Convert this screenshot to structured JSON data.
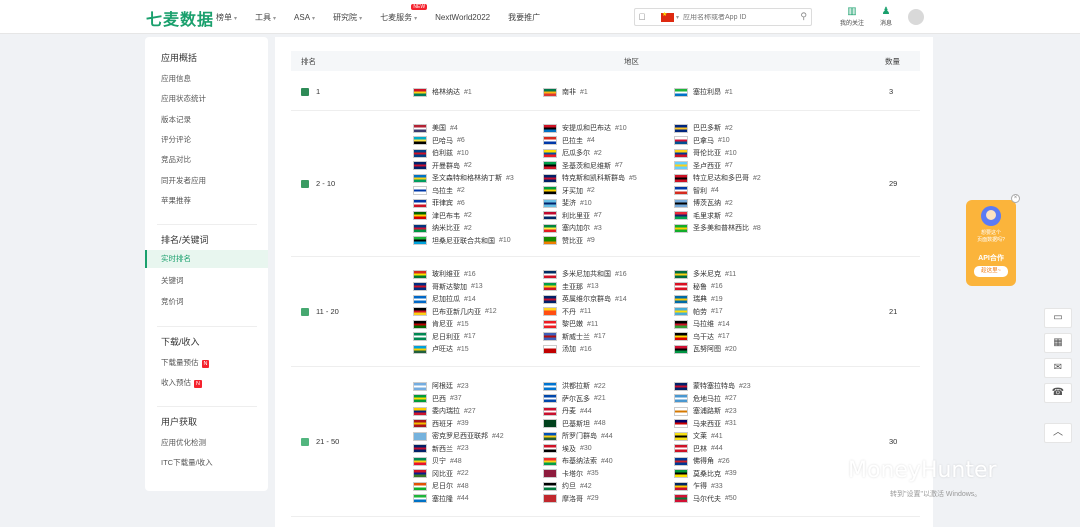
{
  "header": {
    "logo": "七麦数据",
    "nav": [
      {
        "label": "榜单",
        "caret": true
      },
      {
        "label": "工具",
        "caret": true
      },
      {
        "label": "ASA",
        "caret": true
      },
      {
        "label": "研究院",
        "caret": true
      },
      {
        "label": "七麦服务",
        "caret": true,
        "badge": "NEW"
      },
      {
        "label": "NextWorld2022",
        "caret": false
      },
      {
        "label": "我要推广",
        "caret": false
      }
    ],
    "search_placeholder": "应用名称或者App ID",
    "my_follow": "我的关注",
    "message": "消息"
  },
  "sidebar": {
    "groups": [
      {
        "title": "应用概括",
        "items": [
          {
            "label": "应用信息"
          },
          {
            "label": "应用状态统计"
          },
          {
            "label": "版本记录"
          },
          {
            "label": "评分评论"
          },
          {
            "label": "竞品对比"
          },
          {
            "label": "同开发者应用"
          },
          {
            "label": "苹果推荐"
          }
        ]
      },
      {
        "title": "排名/关键词",
        "items": [
          {
            "label": "实时排名",
            "active": true
          },
          {
            "label": "关键词"
          },
          {
            "label": "竞价词"
          }
        ]
      },
      {
        "title": "下载/收入",
        "items": [
          {
            "label": "下载量预估",
            "badge": "N"
          },
          {
            "label": "收入预估",
            "badge": "N"
          }
        ]
      },
      {
        "title": "用户获取",
        "items": [
          {
            "label": "应用优化检测"
          },
          {
            "label": "ITC下载量/收入"
          }
        ]
      }
    ]
  },
  "table": {
    "headers": {
      "rank": "排名",
      "region": "地区",
      "count": "数量"
    },
    "rows": [
      {
        "rank": "1",
        "color": "#2e8b57",
        "count": "3",
        "columns": [
          [
            {
              "name": "格林纳达",
              "rank": "1",
              "f": [
                "#ce1126",
                "#fcd116",
                "#007a5e"
              ]
            }
          ],
          [
            {
              "name": "南非",
              "rank": "1",
              "f": [
                "#007749",
                "#ffb612",
                "#de3831"
              ]
            }
          ],
          [
            {
              "name": "塞拉利昂",
              "rank": "1",
              "f": [
                "#1eb53a",
                "#ffffff",
                "#0072c6"
              ]
            }
          ]
        ]
      },
      {
        "rank": "2 - 10",
        "color": "#3a9b62",
        "count": "29",
        "columns": [
          [
            {
              "name": "美国",
              "rank": "4",
              "f": [
                "#b22234",
                "#ffffff",
                "#3c3b6e"
              ]
            },
            {
              "name": "巴哈马",
              "rank": "6",
              "f": [
                "#00abc9",
                "#fae042",
                "#000000"
              ]
            },
            {
              "name": "伯利兹",
              "rank": "10",
              "f": [
                "#003f87",
                "#ce1126",
                "#003f87"
              ]
            },
            {
              "name": "开曼群岛",
              "rank": "2",
              "f": [
                "#012169",
                "#c8102e",
                "#012169"
              ]
            },
            {
              "name": "圣文森特和格林纳丁斯",
              "rank": "3",
              "f": [
                "#0072c6",
                "#fcd116",
                "#009e60"
              ]
            },
            {
              "name": "乌拉圭",
              "rank": "2",
              "f": [
                "#ffffff",
                "#0038a8",
                "#ffffff"
              ]
            },
            {
              "name": "菲律宾",
              "rank": "6",
              "f": [
                "#0038a8",
                "#ffffff",
                "#ce1126"
              ]
            },
            {
              "name": "津巴布韦",
              "rank": "2",
              "f": [
                "#006400",
                "#ffd200",
                "#d40000"
              ]
            },
            {
              "name": "纳米比亚",
              "rank": "2",
              "f": [
                "#003580",
                "#d21034",
                "#009543"
              ]
            },
            {
              "name": "坦桑尼亚联合共和国",
              "rank": "10",
              "f": [
                "#1eb53a",
                "#000000",
                "#00a3dd"
              ]
            }
          ],
          [
            {
              "name": "安提瓜和巴布达",
              "rank": "10",
              "f": [
                "#ce1126",
                "#000000",
                "#0072c6"
              ]
            },
            {
              "name": "巴拉圭",
              "rank": "4",
              "f": [
                "#d52b1e",
                "#ffffff",
                "#0038a8"
              ]
            },
            {
              "name": "厄瓜多尔",
              "rank": "2",
              "f": [
                "#ffdd00",
                "#034ea2",
                "#ed1c24"
              ]
            },
            {
              "name": "圣基茨和尼维斯",
              "rank": "7",
              "f": [
                "#009e49",
                "#000000",
                "#ce1126"
              ]
            },
            {
              "name": "特克斯和凯科斯群岛",
              "rank": "5",
              "f": [
                "#012169",
                "#c8102e",
                "#012169"
              ]
            },
            {
              "name": "牙买加",
              "rank": "2",
              "f": [
                "#009b3a",
                "#fed100",
                "#000000"
              ]
            },
            {
              "name": "斐济",
              "rank": "10",
              "f": [
                "#68bfe5",
                "#012169",
                "#68bfe5"
              ]
            },
            {
              "name": "利比里亚",
              "rank": "7",
              "f": [
                "#bf0a30",
                "#ffffff",
                "#002868"
              ]
            },
            {
              "name": "塞内加尔",
              "rank": "3",
              "f": [
                "#00853f",
                "#fdef42",
                "#e31b23"
              ]
            },
            {
              "name": "赞比亚",
              "rank": "9",
              "f": [
                "#198a00",
                "#198a00",
                "#ef7d00"
              ]
            }
          ],
          [
            {
              "name": "巴巴多斯",
              "rank": "2",
              "f": [
                "#00267f",
                "#ffc726",
                "#00267f"
              ]
            },
            {
              "name": "巴拿马",
              "rank": "10",
              "f": [
                "#ffffff",
                "#d21034",
                "#005293"
              ]
            },
            {
              "name": "哥伦比亚",
              "rank": "10",
              "f": [
                "#fcd116",
                "#003893",
                "#ce1126"
              ]
            },
            {
              "name": "圣卢西亚",
              "rank": "7",
              "f": [
                "#65cfff",
                "#fcd116",
                "#65cfff"
              ]
            },
            {
              "name": "特立尼达和多巴哥",
              "rank": "2",
              "f": [
                "#ce1126",
                "#000000",
                "#ce1126"
              ]
            },
            {
              "name": "智利",
              "rank": "4",
              "f": [
                "#0039a6",
                "#ffffff",
                "#d52b1e"
              ]
            },
            {
              "name": "博茨瓦纳",
              "rank": "2",
              "f": [
                "#75aadb",
                "#000000",
                "#75aadb"
              ]
            },
            {
              "name": "毛里求斯",
              "rank": "2",
              "f": [
                "#ea2839",
                "#1a206d",
                "#00a551"
              ]
            },
            {
              "name": "圣多美和普林西比",
              "rank": "8",
              "f": [
                "#12ad2b",
                "#ffce00",
                "#12ad2b"
              ]
            }
          ]
        ]
      },
      {
        "rank": "11 - 20",
        "color": "#46a870",
        "count": "21",
        "columns": [
          [
            {
              "name": "玻利维亚",
              "rank": "16",
              "f": [
                "#d52b1e",
                "#f9e300",
                "#007934"
              ]
            },
            {
              "name": "哥斯达黎加",
              "rank": "13",
              "f": [
                "#002b7f",
                "#ce1126",
                "#002b7f"
              ]
            },
            {
              "name": "尼加拉瓜",
              "rank": "14",
              "f": [
                "#0067c6",
                "#ffffff",
                "#0067c6"
              ]
            },
            {
              "name": "巴布亚新几内亚",
              "rank": "12",
              "f": [
                "#000000",
                "#ce1126",
                "#fcd116"
              ]
            },
            {
              "name": "肯尼亚",
              "rank": "15",
              "f": [
                "#000000",
                "#bb0000",
                "#006600"
              ]
            },
            {
              "name": "尼日利亚",
              "rank": "17",
              "f": [
                "#008751",
                "#ffffff",
                "#008751"
              ]
            },
            {
              "name": "卢旺达",
              "rank": "15",
              "f": [
                "#00a1de",
                "#fad201",
                "#20603d"
              ]
            }
          ],
          [
            {
              "name": "多米尼加共和国",
              "rank": "16",
              "f": [
                "#002d62",
                "#ffffff",
                "#ce1126"
              ]
            },
            {
              "name": "圭亚那",
              "rank": "13",
              "f": [
                "#009e49",
                "#fcd116",
                "#ce1126"
              ]
            },
            {
              "name": "英属维尔京群岛",
              "rank": "14",
              "f": [
                "#012169",
                "#c8102e",
                "#012169"
              ]
            },
            {
              "name": "不丹",
              "rank": "11",
              "f": [
                "#ffd520",
                "#ff4e12",
                "#ff4e12"
              ]
            },
            {
              "name": "黎巴嫩",
              "rank": "11",
              "f": [
                "#ed1c24",
                "#ffffff",
                "#ed1c24"
              ]
            },
            {
              "name": "斯威士兰",
              "rank": "17",
              "f": [
                "#3e5eb9",
                "#b10c0c",
                "#3e5eb9"
              ]
            },
            {
              "name": "汤加",
              "rank": "16",
              "f": [
                "#ffffff",
                "#c10000",
                "#c10000"
              ]
            }
          ],
          [
            {
              "name": "多米尼克",
              "rank": "11",
              "f": [
                "#006b3f",
                "#fcd116",
                "#006b3f"
              ]
            },
            {
              "name": "秘鲁",
              "rank": "16",
              "f": [
                "#d91023",
                "#ffffff",
                "#d91023"
              ]
            },
            {
              "name": "瑞典",
              "rank": "19",
              "f": [
                "#006aa7",
                "#fecc00",
                "#006aa7"
              ]
            },
            {
              "name": "帕劳",
              "rank": "17",
              "f": [
                "#4aadd6",
                "#ffde00",
                "#4aadd6"
              ]
            },
            {
              "name": "马拉维",
              "rank": "14",
              "f": [
                "#000000",
                "#ce1126",
                "#339e35"
              ]
            },
            {
              "name": "乌干达",
              "rank": "17",
              "f": [
                "#000000",
                "#fcdc04",
                "#d90000"
              ]
            },
            {
              "name": "瓦努阿图",
              "rank": "20",
              "f": [
                "#d21034",
                "#000000",
                "#009543"
              ]
            }
          ]
        ]
      },
      {
        "rank": "21 - 50",
        "color": "#52b57e",
        "count": "30",
        "columns": [
          [
            {
              "name": "阿根廷",
              "rank": "23",
              "f": [
                "#74acdf",
                "#ffffff",
                "#74acdf"
              ]
            },
            {
              "name": "巴西",
              "rank": "37",
              "f": [
                "#009c3b",
                "#ffdf00",
                "#009c3b"
              ]
            },
            {
              "name": "委内瑞拉",
              "rank": "27",
              "f": [
                "#ffcc00",
                "#00247d",
                "#cf142b"
              ]
            },
            {
              "name": "西班牙",
              "rank": "39",
              "f": [
                "#aa151b",
                "#f1bf00",
                "#aa151b"
              ]
            },
            {
              "name": "密克罗尼西亚联邦",
              "rank": "42",
              "f": [
                "#75b2dd",
                "#75b2dd",
                "#75b2dd"
              ]
            },
            {
              "name": "新西兰",
              "rank": "23",
              "f": [
                "#012169",
                "#c8102e",
                "#012169"
              ]
            },
            {
              "name": "贝宁",
              "rank": "48",
              "f": [
                "#008751",
                "#fcd116",
                "#e8112d"
              ]
            },
            {
              "name": "冈比亚",
              "rank": "22",
              "f": [
                "#ce1126",
                "#0c1c8c",
                "#3a7728"
              ]
            },
            {
              "name": "尼日尔",
              "rank": "48",
              "f": [
                "#e05206",
                "#ffffff",
                "#0db02b"
              ]
            },
            {
              "name": "塞拉隆",
              "rank": "44",
              "f": [
                "#1eb53a",
                "#ffffff",
                "#0072c6"
              ]
            }
          ],
          [
            {
              "name": "洪都拉斯",
              "rank": "22",
              "f": [
                "#0073cf",
                "#ffffff",
                "#0073cf"
              ]
            },
            {
              "name": "萨尔瓦多",
              "rank": "21",
              "f": [
                "#0047ab",
                "#ffffff",
                "#0047ab"
              ]
            },
            {
              "name": "丹麦",
              "rank": "44",
              "f": [
                "#c8102e",
                "#ffffff",
                "#c8102e"
              ]
            },
            {
              "name": "巴基斯坦",
              "rank": "48",
              "f": [
                "#01411c",
                "#01411c",
                "#01411c"
              ]
            },
            {
              "name": "所罗门群岛",
              "rank": "44",
              "f": [
                "#0051ba",
                "#fcd116",
                "#215b33"
              ]
            },
            {
              "name": "埃及",
              "rank": "30",
              "f": [
                "#ce1126",
                "#ffffff",
                "#000000"
              ]
            },
            {
              "name": "布基纳法索",
              "rank": "40",
              "f": [
                "#ef2b2d",
                "#fcd116",
                "#009e49"
              ]
            },
            {
              "name": "卡塔尔",
              "rank": "35",
              "f": [
                "#8d1b3d",
                "#8d1b3d",
                "#8d1b3d"
              ]
            },
            {
              "name": "约旦",
              "rank": "42",
              "f": [
                "#000000",
                "#ffffff",
                "#007a3d"
              ]
            },
            {
              "name": "摩洛哥",
              "rank": "29",
              "f": [
                "#c1272d",
                "#c1272d",
                "#c1272d"
              ]
            }
          ],
          [
            {
              "name": "蒙特塞拉特岛",
              "rank": "23",
              "f": [
                "#012169",
                "#c8102e",
                "#012169"
              ]
            },
            {
              "name": "危地马拉",
              "rank": "27",
              "f": [
                "#4997d0",
                "#ffffff",
                "#4997d0"
              ]
            },
            {
              "name": "塞浦路斯",
              "rank": "23",
              "f": [
                "#ffffff",
                "#d57800",
                "#ffffff"
              ]
            },
            {
              "name": "马来西亚",
              "rank": "31",
              "f": [
                "#010066",
                "#cc0001",
                "#ffffff"
              ]
            },
            {
              "name": "文莱",
              "rank": "41",
              "f": [
                "#f7e017",
                "#000000",
                "#f7e017"
              ]
            },
            {
              "name": "巴林",
              "rank": "44",
              "f": [
                "#ce1126",
                "#ffffff",
                "#ce1126"
              ]
            },
            {
              "name": "佛得角",
              "rank": "26",
              "f": [
                "#003893",
                "#cf2027",
                "#003893"
              ]
            },
            {
              "name": "莫桑比克",
              "rank": "39",
              "f": [
                "#009739",
                "#000000",
                "#fce100"
              ]
            },
            {
              "name": "乍得",
              "rank": "33",
              "f": [
                "#002664",
                "#fecb00",
                "#c60c30"
              ]
            },
            {
              "name": "马尔代夫",
              "rank": "50",
              "f": [
                "#d21034",
                "#007e3a",
                "#d21034"
              ]
            }
          ]
        ]
      }
    ]
  },
  "api_card": {
    "line1": "想要这个",
    "line2": "页面数据吗?",
    "title": "API合作",
    "cta": "趁这里~"
  },
  "watermark": "MoneyHunter",
  "activation": "转到\"设置\"以激活 Windows。"
}
